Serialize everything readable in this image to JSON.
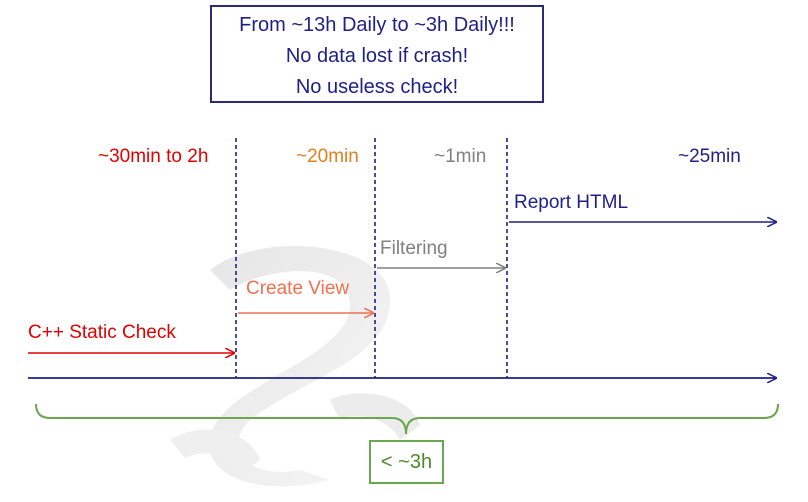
{
  "colors": {
    "navy": "#1f1f8a",
    "red": "#e00000",
    "orange": "#e08020",
    "gray": "#808080",
    "salmon": "#f07050",
    "green": "#6aa84f"
  },
  "headline": {
    "line1": "From ~13h Daily to ~3h Daily!!!",
    "line2": "No data lost if crash!",
    "line3": "No useless check!"
  },
  "durations": {
    "static_check": "~30min to 2h",
    "create_view": "~20min",
    "filtering": "~1min",
    "report": "~25min"
  },
  "stages": {
    "static_check": "C++ Static Check",
    "create_view": "Create View",
    "filtering": "Filtering",
    "report": "Report HTML"
  },
  "total": "< ~3h"
}
